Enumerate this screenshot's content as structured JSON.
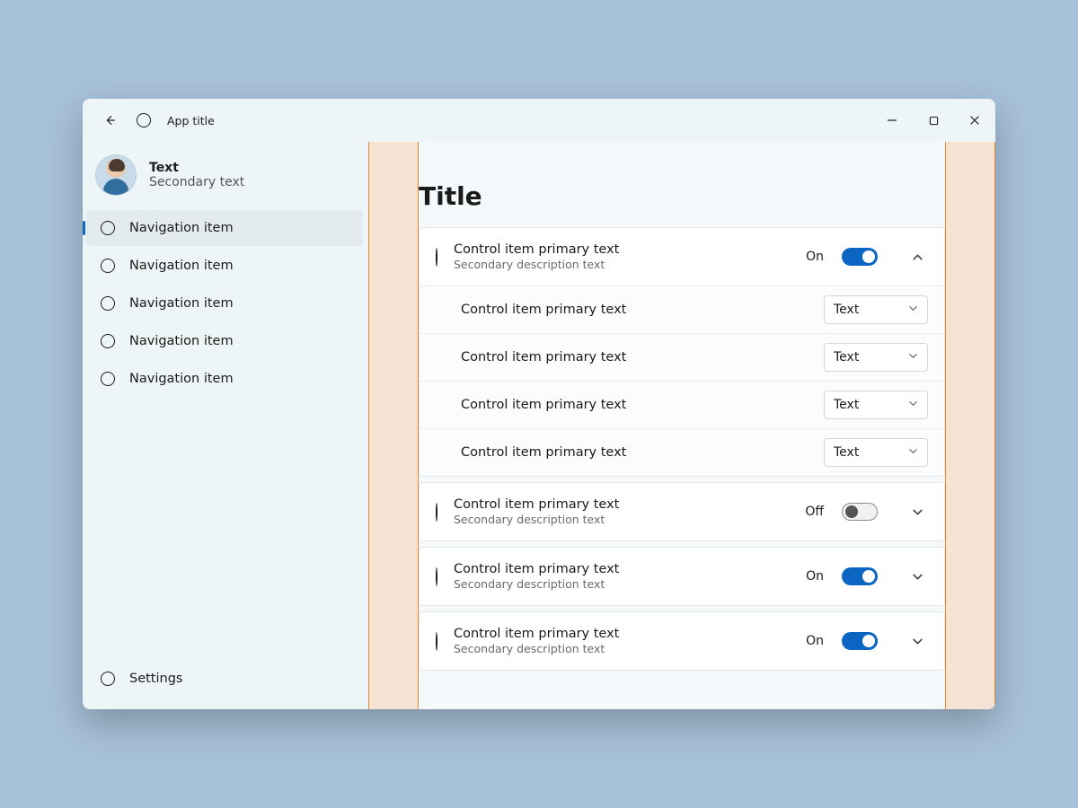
{
  "titlebar": {
    "app_title": "App title"
  },
  "profile": {
    "primary": "Text",
    "secondary": "Secondary text"
  },
  "nav": {
    "items": [
      {
        "label": "Navigation item",
        "selected": true
      },
      {
        "label": "Navigation item",
        "selected": false
      },
      {
        "label": "Navigation item",
        "selected": false
      },
      {
        "label": "Navigation item",
        "selected": false
      },
      {
        "label": "Navigation item",
        "selected": false
      }
    ],
    "settings_label": "Settings"
  },
  "page": {
    "title": "Title",
    "groups": [
      {
        "primary": "Control item primary text",
        "secondary": "Secondary description text",
        "state_label": "On",
        "toggle": "on",
        "expanded": true,
        "children": [
          {
            "primary": "Control item primary text",
            "dropdown_value": "Text"
          },
          {
            "primary": "Control item primary text",
            "dropdown_value": "Text"
          },
          {
            "primary": "Control item primary text",
            "dropdown_value": "Text"
          },
          {
            "primary": "Control item primary text",
            "dropdown_value": "Text"
          }
        ]
      },
      {
        "primary": "Control item primary text",
        "secondary": "Secondary description text",
        "state_label": "Off",
        "toggle": "off",
        "expanded": false
      },
      {
        "primary": "Control item primary text",
        "secondary": "Secondary description text",
        "state_label": "On",
        "toggle": "on",
        "expanded": false
      },
      {
        "primary": "Control item primary text",
        "secondary": "Secondary description text",
        "state_label": "On",
        "toggle": "on",
        "expanded": false
      }
    ]
  }
}
